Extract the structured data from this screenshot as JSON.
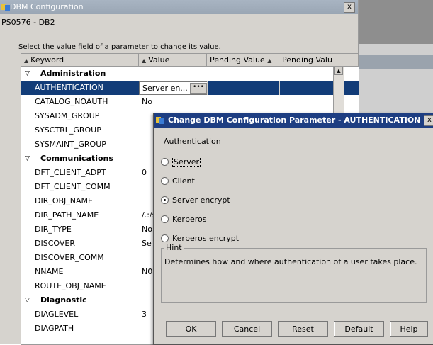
{
  "main_window": {
    "title": "DBM Configuration",
    "close_glyph": "x",
    "subtitle": "PS0576 - DB2"
  },
  "instruction": "Select the value field of a parameter to change its value.",
  "table": {
    "columns": [
      "Keyword",
      "Value",
      "Pending Value",
      "Pending Valu"
    ],
    "rows": [
      {
        "type": "group",
        "keyword": "Administration",
        "value": ""
      },
      {
        "type": "item",
        "keyword": "AUTHENTICATION",
        "value": "Server en...",
        "selected": true
      },
      {
        "type": "item",
        "keyword": "CATALOG_NOAUTH",
        "value": "No"
      },
      {
        "type": "item",
        "keyword": "SYSADM_GROUP",
        "value": ""
      },
      {
        "type": "item",
        "keyword": "SYSCTRL_GROUP",
        "value": ""
      },
      {
        "type": "item",
        "keyword": "SYSMAINT_GROUP",
        "value": ""
      },
      {
        "type": "group",
        "keyword": "Communications",
        "value": ""
      },
      {
        "type": "item",
        "keyword": "DFT_CLIENT_ADPT",
        "value": "0"
      },
      {
        "type": "item",
        "keyword": "DFT_CLIENT_COMM",
        "value": ""
      },
      {
        "type": "item",
        "keyword": "DIR_OBJ_NAME",
        "value": ""
      },
      {
        "type": "item",
        "keyword": "DIR_PATH_NAME",
        "value": "/.:/s"
      },
      {
        "type": "item",
        "keyword": "DIR_TYPE",
        "value": "No"
      },
      {
        "type": "item",
        "keyword": "DISCOVER",
        "value": "Se"
      },
      {
        "type": "item",
        "keyword": "DISCOVER_COMM",
        "value": ""
      },
      {
        "type": "item",
        "keyword": "NNAME",
        "value": "N0"
      },
      {
        "type": "item",
        "keyword": "ROUTE_OBJ_NAME",
        "value": ""
      },
      {
        "type": "group",
        "keyword": "Diagnostic",
        "value": ""
      },
      {
        "type": "item",
        "keyword": "DIAGLEVEL",
        "value": "3"
      },
      {
        "type": "item",
        "keyword": "DIAGPATH",
        "value": ""
      }
    ],
    "edit_button_glyph": "•••"
  },
  "dialog": {
    "title": "Change DBM Configuration Parameter - AUTHENTICATION",
    "close_glyph": "x",
    "heading": "Authentication",
    "options": [
      {
        "label": "Server",
        "selected": false,
        "focused": true
      },
      {
        "label": "Client",
        "selected": false
      },
      {
        "label": "Server encrypt",
        "selected": true
      },
      {
        "label": "Kerberos",
        "selected": false
      },
      {
        "label": "Kerberos encrypt",
        "selected": false
      }
    ],
    "hint_label": "Hint",
    "hint_text": "Determines how and where authentication of a user takes place.",
    "buttons": {
      "ok": "OK",
      "cancel": "Cancel",
      "reset": "Reset",
      "default": "Default",
      "help": "Help"
    }
  },
  "background_window": {
    "minimize_glyph": "_"
  },
  "colors": {
    "selection": "#123c78",
    "dialog_title": "#1e3e82",
    "window_bg": "#d6d3ce"
  }
}
